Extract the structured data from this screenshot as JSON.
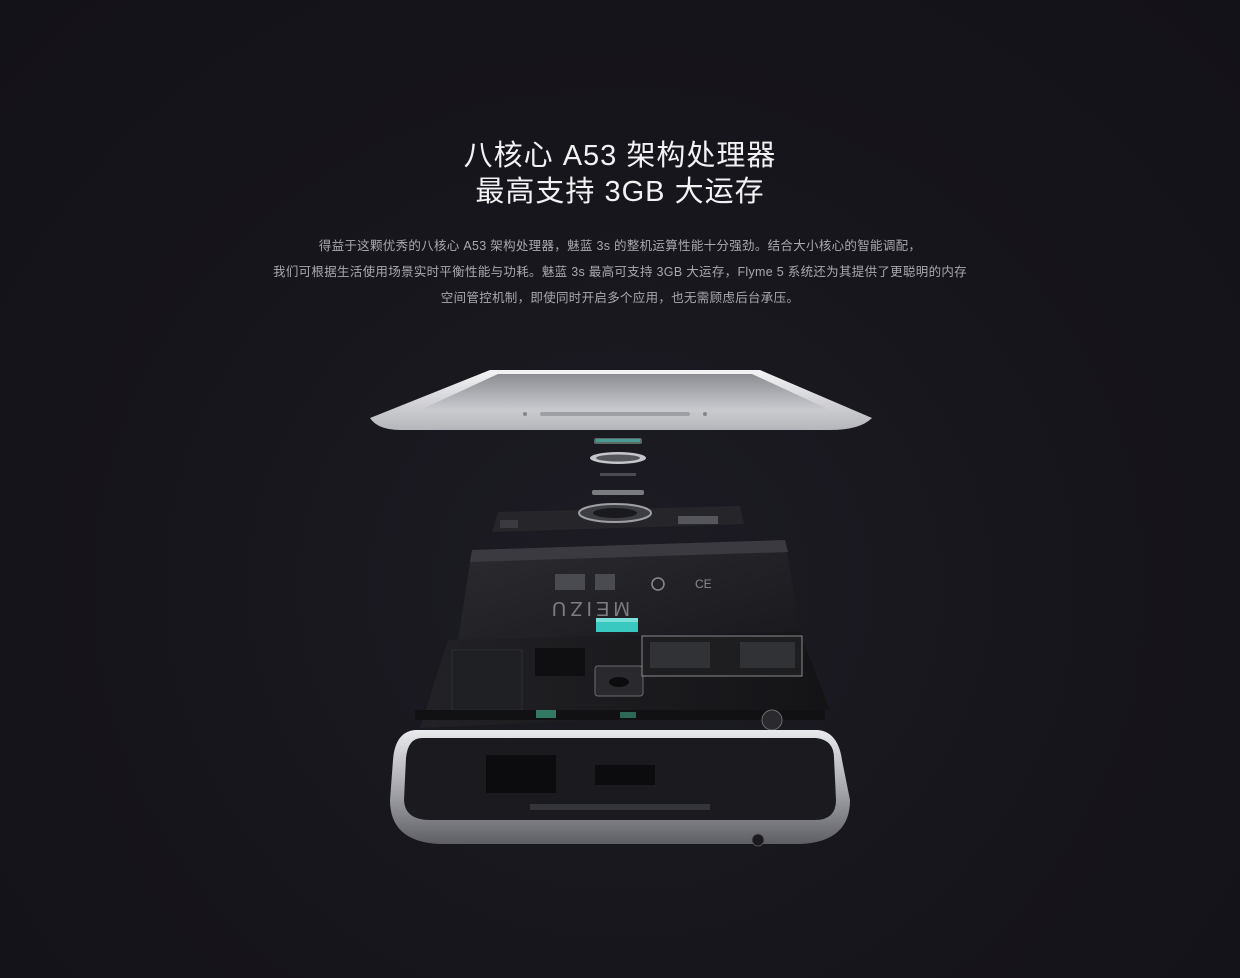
{
  "headline": {
    "line1": "八核心 A53 架构处理器",
    "line2": "最高支持 3GB 大运存"
  },
  "description": {
    "line1": "得益于这颗优秀的八核心 A53 架构处理器，魅蓝 3s 的整机运算性能十分强劲。结合大小核心的智能调配，",
    "line2": "我们可根据生活使用场景实时平衡性能与功耗。魅蓝 3s 最高可支持 3GB 大运存，Flyme 5 系统还为其提供了更聪明的内存",
    "line3": "空间管控机制，即使同时开启多个应用，也无需顾虑后台承压。"
  },
  "illustration": {
    "battery_brand": "MEIZU",
    "colors": {
      "background": "#17161d",
      "frame_silver": "#cfd0d4",
      "board": "#1b1b1e",
      "chip_accent": "#3ac9c0"
    }
  }
}
